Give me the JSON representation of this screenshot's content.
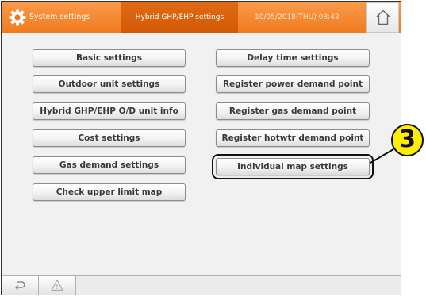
{
  "header": {
    "title": "System settings",
    "tab": "Hybrid GHP/EHP settings",
    "datetime": "10/05/2018(THU) 08:43",
    "icons": {
      "settings": "gear-icon",
      "home": "home-icon"
    }
  },
  "buttons": {
    "basic": "Basic settings",
    "outdoor_unit": "Outdoor unit settings",
    "hybrid_od_info": "Hybrid GHP/EHP O/D unit info",
    "cost": "Cost settings",
    "gas_demand": "Gas demand settings",
    "upper_limit_map": "Check upper limit map",
    "delay_time": "Delay time settings",
    "power_demand_point": "Register power demand point",
    "gas_demand_point": "Register gas demand point",
    "hotwtr_demand_point": "Register hotwtr demand point",
    "individual_map": "Individual map settings"
  },
  "callout": {
    "number": "3"
  },
  "footer": {
    "icons": [
      "back-icon",
      "warning-icon"
    ]
  },
  "colors": {
    "header_orange": "#f07a1f",
    "active_tab": "#d25a06",
    "callout_yellow": "#ffee00"
  }
}
